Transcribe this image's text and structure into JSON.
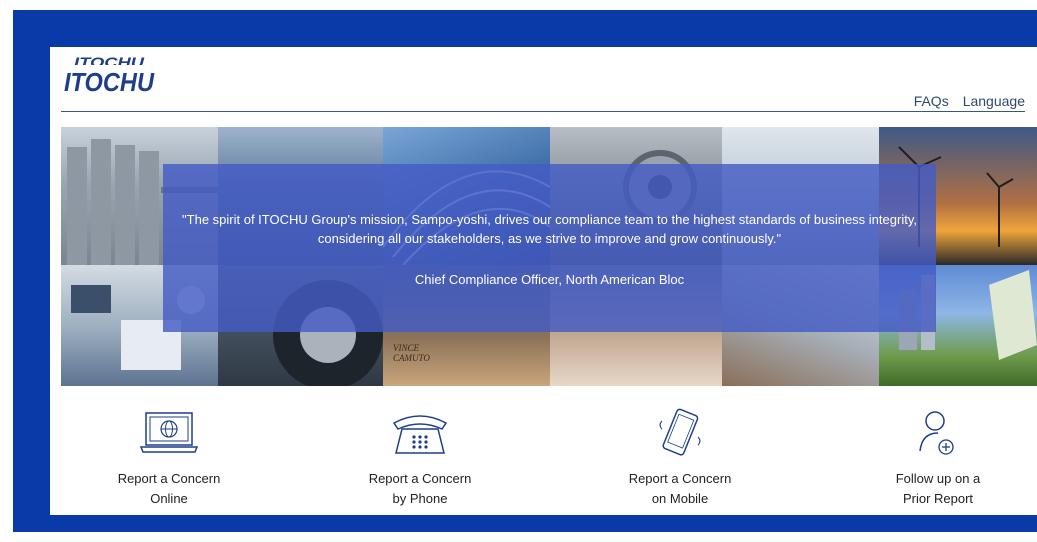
{
  "brand": {
    "logo_text": "ITOCHU"
  },
  "nav": {
    "faqs": "FAQs",
    "language": "Language"
  },
  "hero": {
    "quote": "\"The spirit of ITOCHU Group's mission, Sampo-yoshi, drives our compliance team to the highest standards of business integrity, considering all our stakeholders, as we strive to improve and grow continuously.\"",
    "attribution": "Chief Compliance Officer, North American Bloc",
    "photo_text": "VINCE CAMUTO"
  },
  "actions": [
    {
      "line1": "Report a Concern",
      "line2": "Online",
      "icon": "laptop-globe-icon"
    },
    {
      "line1": "Report a Concern",
      "line2": "by Phone",
      "icon": "telephone-icon"
    },
    {
      "line1": "Report a Concern",
      "line2": "on Mobile",
      "icon": "mobile-phone-icon"
    },
    {
      "line1": "Follow up on a",
      "line2": "Prior Report",
      "icon": "user-add-icon"
    }
  ],
  "colors": {
    "frame": "#0a3aa8",
    "overlay": "#445cc4",
    "icon": "#1d3f8a"
  }
}
